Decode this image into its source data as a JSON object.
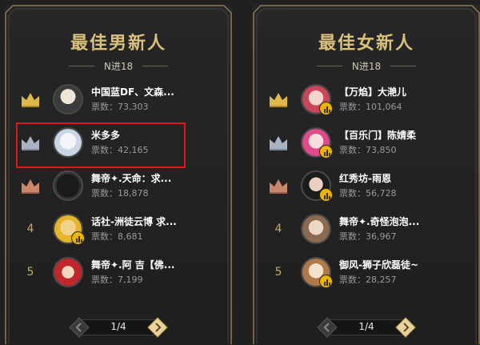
{
  "colors": {
    "gold": "#d9c07c",
    "panel_bg": "#232323",
    "frame_gold": "#8f7a52",
    "highlight": "#e0161f",
    "badge": "#e8b500"
  },
  "panels": [
    {
      "title": "最佳男新人",
      "subtitle": "N进18",
      "pager": "1/4",
      "entries": [
        {
          "rank": "1",
          "crown": "gold-crown-icon",
          "name": "中国蓝DF、文森...",
          "votes": "票数：73,303",
          "badge": false
        },
        {
          "rank": "2",
          "crown": "silver-crown-icon",
          "name": "米多多",
          "votes": "票数：42,165",
          "badge": false
        },
        {
          "rank": "3",
          "crown": "bronze-crown-icon",
          "name": "舞帝✦.天命：求...",
          "votes": "票数：18,878",
          "badge": false
        },
        {
          "rank": "4",
          "crown": "",
          "name": "话社-洲徒云博 求...",
          "votes": "票数：8,681",
          "badge": true
        },
        {
          "rank": "5",
          "crown": "",
          "name": "舞帝✦.阿 吉【佛...",
          "votes": "票数：7,199",
          "badge": false
        }
      ]
    },
    {
      "title": "最佳女新人",
      "subtitle": "N进18",
      "pager": "1/4",
      "entries": [
        {
          "rank": "1",
          "crown": "gold-crown-icon",
          "name": "【万焰】大滟儿",
          "votes": "票数：101,064",
          "badge": true
        },
        {
          "rank": "2",
          "crown": "silver-crown-icon",
          "name": "【百乐门】陈婧柔",
          "votes": "票数：73,850",
          "badge": true
        },
        {
          "rank": "3",
          "crown": "bronze-crown-icon",
          "name": "红秀坊-雨恩",
          "votes": "票数：56,728",
          "badge": true
        },
        {
          "rank": "4",
          "crown": "",
          "name": "舞帝✦.奇怪泡泡...",
          "votes": "票数：36,967",
          "badge": false
        },
        {
          "rank": "5",
          "crown": "",
          "name": "御风-狮子欣磊徒~",
          "votes": "票数：28,257",
          "badge": true
        }
      ]
    }
  ]
}
